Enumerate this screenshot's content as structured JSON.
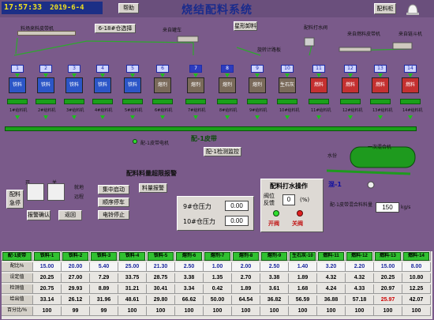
{
  "header": {
    "time": "17:57:33",
    "date": "2019-6-4",
    "help_label": "帮助",
    "title": "烧结配料系统",
    "cabinet_label": "配料柜"
  },
  "upper": {
    "conveyor_label": "料场来料皮带机",
    "bin_618_label": "6-18#仓选择",
    "dyn_label": "来自罐车",
    "fault_label": "星形卸料",
    "sprinkler_label": "配料打水阀",
    "auto_label": "来自燃料皮带机",
    "inst_label": "来自链斗机",
    "cement_label": "旋转计路板"
  },
  "hoppers": [
    {
      "num": "1",
      "name": "铁料",
      "blue": false,
      "color": "#2c56c7"
    },
    {
      "num": "2",
      "name": "铁料",
      "blue": false,
      "color": "#2c56c7"
    },
    {
      "num": "3",
      "name": "铁料",
      "blue": false,
      "color": "#2c56c7"
    },
    {
      "num": "4",
      "name": "铁料",
      "blue": false,
      "color": "#2c56c7"
    },
    {
      "num": "5",
      "name": "铁料",
      "blue": false,
      "color": "#2c56c7"
    },
    {
      "num": "6",
      "name": "熔剂",
      "blue": false,
      "color": "#7a6a5a"
    },
    {
      "num": "7",
      "name": "熔剂",
      "blue": true,
      "color": "#7a6a5a"
    },
    {
      "num": "8",
      "name": "熔剂",
      "blue": true,
      "color": "#7a6a5a"
    },
    {
      "num": "9",
      "name": "熔剂",
      "blue": false,
      "color": "#7a6a5a"
    },
    {
      "num": "10",
      "name": "生石灰",
      "blue": false,
      "color": "#7a6a5a"
    },
    {
      "num": "11",
      "name": "燃料",
      "blue": false,
      "color": "#c43030"
    },
    {
      "num": "12",
      "name": "燃料",
      "blue": false,
      "color": "#c43030"
    },
    {
      "num": "13",
      "name": "燃料",
      "blue": false,
      "color": "#c43030"
    },
    {
      "num": "14",
      "name": "燃料",
      "blue": false,
      "color": "#c43030"
    }
  ],
  "feeder_label": "给料机",
  "belt": {
    "label": "配-1皮带",
    "motor_label": "配-1皮带电机",
    "monitor_label": "配-1检测监控"
  },
  "alarm_title": "配料料量超限报警",
  "alarm_btn": "料量报警",
  "controls": {
    "emergency": "配料急停",
    "switch1": "开",
    "switch2": "关",
    "local": "就地",
    "remote": "远程",
    "confirm": "报警确认",
    "reset": "返回",
    "central_start": "集中启动",
    "seq_stop": "顺序停车",
    "motor_stop": "电铃停止"
  },
  "pressure": {
    "p9_label": "9#仓压力",
    "p9_value": "0.00",
    "p10_label": "10#仓压力",
    "p10_value": "0.00"
  },
  "water": {
    "title": "配料打水操作",
    "valve_label": "阀位反馈",
    "valve_value": "0",
    "unit": "(%)",
    "open": "开阀",
    "close": "关阀"
  },
  "mixer": {
    "label": "一次混合机",
    "mix_label": "混-1",
    "water_label": "水份",
    "belt_label": "配-1皮带混合料料量",
    "flow_value": "150",
    "flow_unit": "kg/s"
  },
  "table": {
    "columns": [
      "配-1皮带",
      "铁料-1",
      "铁料-2",
      "铁料-3",
      "铁料-4",
      "铁料-5",
      "熔剂-6",
      "熔剂-7",
      "熔剂-8",
      "熔剂-9",
      "生石灰-10",
      "燃料-11",
      "燃料-12",
      "燃料-13",
      "燃料-14"
    ],
    "rows": [
      {
        "label": "配比%",
        "values": [
          "15.00",
          "20.00",
          "5.40",
          "25.00",
          "21.30",
          "2.50",
          "1.00",
          "2.00",
          "2.50",
          "1.40",
          "3.20",
          "2.20",
          "15.00",
          "8.00"
        ],
        "input": true
      },
      {
        "label": "设定值",
        "values": [
          "20.25",
          "27.00",
          "7.29",
          "33.75",
          "28.75",
          "3.38",
          "1.35",
          "2.70",
          "3.38",
          "1.89",
          "4.32",
          "4.32",
          "20.25",
          "10.80"
        ],
        "input": false
      },
      {
        "label": "检测值",
        "values": [
          "20.75",
          "29.93",
          "8.89",
          "31.21",
          "30.41",
          "3.34",
          "0.42",
          "1.89",
          "3.61",
          "1.68",
          "4.24",
          "4.33",
          "20.97",
          "12.25"
        ],
        "input": false
      },
      {
        "label": "给出值",
        "values": [
          "33.14",
          "26.12",
          "31.96",
          "48.61",
          "29.80",
          "66.62",
          "50.00",
          "64.54",
          "36.82",
          "56.59",
          "36.88",
          "57.18",
          "25.97",
          "42.07"
        ],
        "input": false,
        "red_index": 12
      },
      {
        "label": "百分比/%",
        "values": [
          "100",
          "99",
          "99",
          "100",
          "100",
          "100",
          "100",
          "100",
          "100",
          "100",
          "100",
          "100",
          "100",
          "100"
        ],
        "input": false
      }
    ]
  }
}
